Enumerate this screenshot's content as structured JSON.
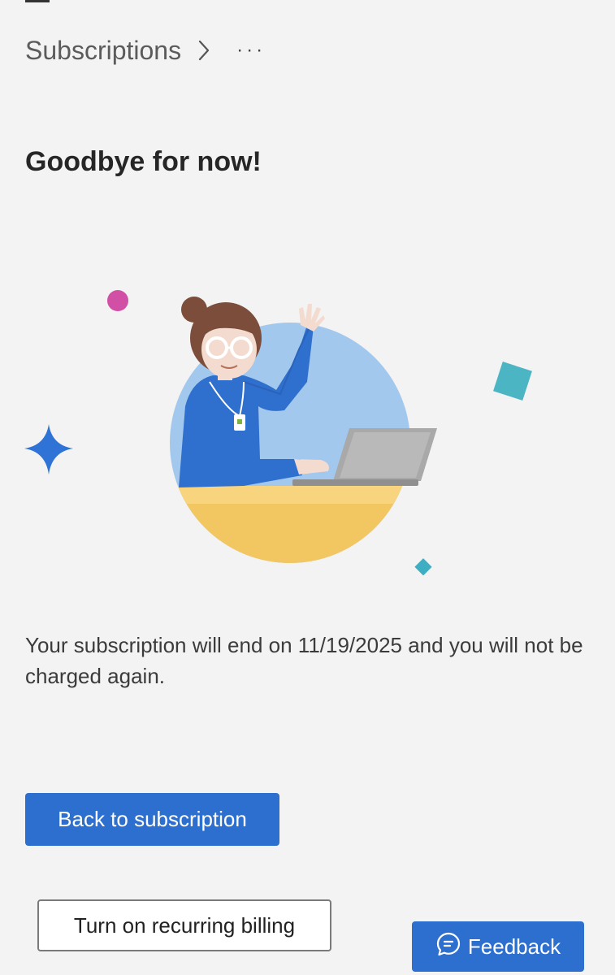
{
  "header": {
    "breadcrumb": "Subscriptions",
    "more_label": "···"
  },
  "main": {
    "title": "Goodbye for now!",
    "message": "Your subscription will end on 11/19/2025 and you will not be charged again.",
    "illustration_icon": "woman-waving-at-laptop-illustration"
  },
  "actions": {
    "back_label": "Back to subscription",
    "recurring_label": "Turn on recurring billing",
    "feedback_label": "Feedback"
  },
  "colors": {
    "background": "#f3f3f3",
    "accent": "#2d6fcf"
  }
}
